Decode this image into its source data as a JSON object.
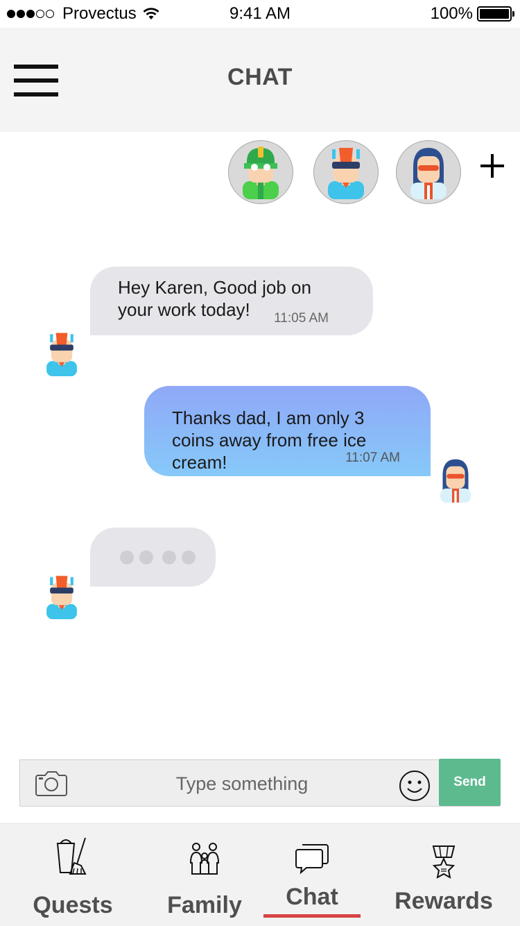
{
  "status_bar": {
    "carrier": "Provectus",
    "time": "9:41 AM",
    "battery": "100%",
    "signal_bars_filled": 3,
    "signal_bars_total": 5
  },
  "header": {
    "title": "CHAT",
    "menu_icon": "hamburger-menu-icon"
  },
  "participants": [
    {
      "avatar": "green-hero-avatar"
    },
    {
      "avatar": "blue-hero-avatar"
    },
    {
      "avatar": "girl-hero-avatar"
    }
  ],
  "add_participant_icon": "plus-icon",
  "messages": [
    {
      "direction": "incoming",
      "text": "Hey Karen, Good job on your work today!",
      "time": "11:05 AM",
      "avatar": "blue-hero-avatar"
    },
    {
      "direction": "outgoing",
      "text": "Thanks dad, I am only 3 coins away from free ice cream!",
      "time": "11:07 AM",
      "avatar": "girl-hero-avatar"
    }
  ],
  "typing_indicator": {
    "dots": 4,
    "avatar": "blue-hero-avatar"
  },
  "composer": {
    "placeholder": "Type something",
    "value": "",
    "send_label": "Send",
    "camera_icon": "camera-icon",
    "emoji_icon": "smiley-icon"
  },
  "tabs": [
    {
      "label": "Quests",
      "icon": "bucket-broom-icon",
      "active": false
    },
    {
      "label": "Family",
      "icon": "family-icon",
      "active": false
    },
    {
      "label": "Chat",
      "icon": "chat-bubbles-icon",
      "active": true
    },
    {
      "label": "Rewards",
      "icon": "medal-icon",
      "active": false
    }
  ],
  "colors": {
    "accent_underline": "#d64543",
    "send_button": "#5dba8f",
    "incoming_bubble": "#e6e6ea",
    "outgoing_bubble_top": "#8fa8f7",
    "outgoing_bubble_bottom": "#86c9f9",
    "header_bg": "#f4f4f4"
  }
}
